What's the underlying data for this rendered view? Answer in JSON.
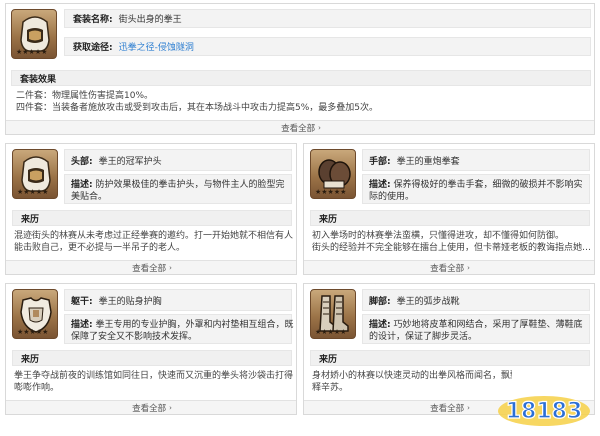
{
  "set": {
    "name_label": "套装名称:",
    "name_value": "街头出身的拳王",
    "source_label": "获取途径:",
    "source_value": "迅拳之径-侵蚀隧洞",
    "effect_title": "套装效果",
    "effect_lines": [
      "二件套：物理属性伤害提高10%。",
      "四件套：当装备者施放攻击或受到攻击后，其在本场战斗中攻击力提高5%，最多叠加5次。"
    ],
    "more": "查看全部"
  },
  "pieces": [
    {
      "slot_label": "头部:",
      "name": "拳王的冠军护头",
      "desc_label": "描述:",
      "desc_lines": [
        "防护效果极佳的拳击护头，与物件主人的脸型完",
        "美贴合。"
      ],
      "story_title": "来历",
      "story_lines": [
        "混迹街头的林赛从未考虑过正经拳赛的邀约。打一开始她就不相信有人",
        "能击败自己，更不必提与一半吊子的老人。"
      ],
      "more": "查看全部",
      "icon": "boxing-headgear-icon",
      "stars": "★★★★★"
    },
    {
      "slot_label": "手部:",
      "name": "拳王的重炮拳套",
      "desc_label": "描述:",
      "desc_lines": [
        "保养得极好的拳击手套，细微的破损并不影响实",
        "际的使用。"
      ],
      "story_title": "来历",
      "story_lines": [
        "初入拳场时的林赛拳法蛮横，只懂得进攻，却不懂得如何防御。",
        "街头的经验并不完全能够在擂台上使用，但卡蒂娅老板的教诲指点她…"
      ],
      "more": "查看全部",
      "icon": "boxing-gloves-icon",
      "stars": "★★★★★"
    },
    {
      "slot_label": "躯干:",
      "name": "拳王的贴身护胸",
      "desc_label": "描述:",
      "desc_lines": [
        "拳王专用的专业护胸，外罩和内衬垫相互组合，既",
        "保障了安全又不影响技术发挥。"
      ],
      "story_title": "来历",
      "story_lines": [
        "拳王争夺战前夜的训练馆如同往日，快速而又沉重的拳头将沙袋击打得",
        "嘭嘭作响。"
      ],
      "more": "查看全部",
      "icon": "chest-guard-icon",
      "stars": "★★★★★"
    },
    {
      "slot_label": "脚部:",
      "name": "拳王的弧步战靴",
      "desc_label": "描述:",
      "desc_lines": [
        "巧妙地将皮革和网结合，采用了厚鞋垫、薄鞋底",
        "的设计，保证了脚步灵活。"
      ],
      "story_title": "来历",
      "story_lines": [
        "身材娇小的林赛以快速灵动的出拳风格而闻名，飘飘的步法轻易地解",
        "释辛苏。"
      ],
      "more": "查看全部",
      "icon": "combat-boots-icon",
      "stars": "★★★★★"
    }
  ],
  "watermark": {
    "text": "18183"
  },
  "colors": {
    "link": "#2f7fd1",
    "icon_bg": "#b08a5e"
  }
}
